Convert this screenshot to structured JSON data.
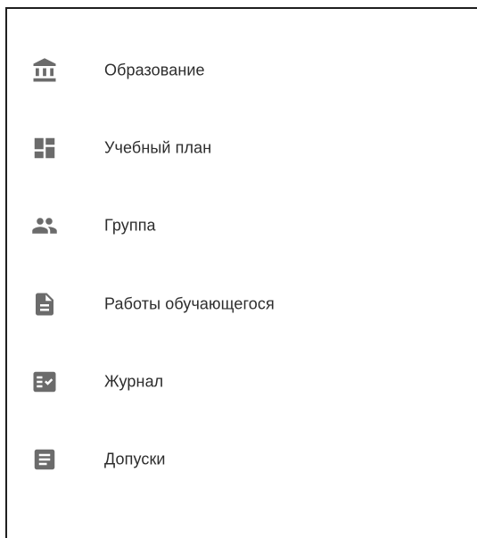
{
  "menu": {
    "items": [
      {
        "label": "Образование",
        "icon": "bank-icon"
      },
      {
        "label": "Учебный план",
        "icon": "dashboard-icon"
      },
      {
        "label": "Группа",
        "icon": "people-icon"
      },
      {
        "label": "Работы обучающегося",
        "icon": "document-icon"
      },
      {
        "label": "Журнал",
        "icon": "fact-check-icon"
      },
      {
        "label": "Допуски",
        "icon": "article-icon"
      }
    ]
  },
  "colors": {
    "icon": "#6b6b6b",
    "text": "#2d2d2d",
    "border": "#1f1f1f"
  }
}
